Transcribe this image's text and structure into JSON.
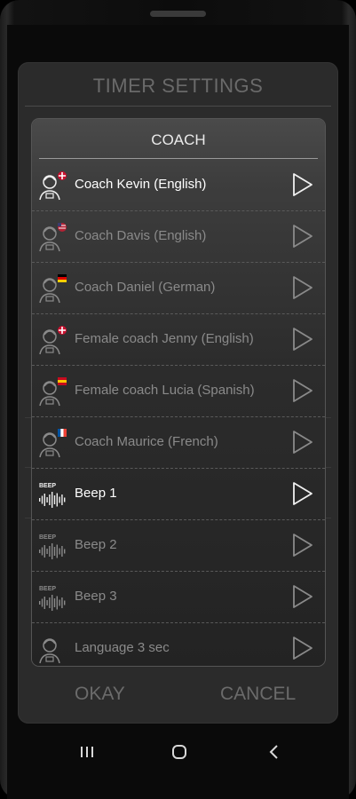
{
  "timer_settings": {
    "title": "TIMER SETTINGS",
    "okay_label": "OKAY",
    "cancel_label": "CANCEL"
  },
  "coach_dialog": {
    "title": "COACH",
    "items": [
      {
        "label": "Coach Kevin (English)",
        "icon": "coach-avatar-icon",
        "flag": "uk-flag",
        "active": true
      },
      {
        "label": "Coach Davis (English)",
        "icon": "coach-avatar-icon",
        "flag": "us-flag",
        "active": false
      },
      {
        "label": "Coach Daniel (German)",
        "icon": "coach-avatar-icon",
        "flag": "german-flag",
        "active": false
      },
      {
        "label": "Female coach Jenny (English)",
        "icon": "coach-avatar-icon",
        "flag": "uk-flag",
        "active": false
      },
      {
        "label": "Female coach Lucia (Spanish)",
        "icon": "coach-avatar-icon",
        "flag": "spanish-flag",
        "active": false
      },
      {
        "label": "Coach Maurice (French)",
        "icon": "coach-avatar-icon",
        "flag": "french-flag",
        "active": false
      },
      {
        "label": "Beep 1",
        "icon": "beep-waveform-icon",
        "icon_text": "BEEP",
        "active": true
      },
      {
        "label": "Beep 2",
        "icon": "beep-waveform-icon",
        "icon_text": "BEEP",
        "active": false
      },
      {
        "label": "Beep 3",
        "icon": "beep-waveform-icon",
        "icon_text": "BEEP",
        "active": false
      },
      {
        "label": "Language 3 sec",
        "icon": "coach-avatar-icon",
        "active": false
      }
    ]
  },
  "colors": {
    "active_text": "#ffffff",
    "inactive_text": "#8a8a8a",
    "dialog_bg": "#2b2b2b"
  }
}
